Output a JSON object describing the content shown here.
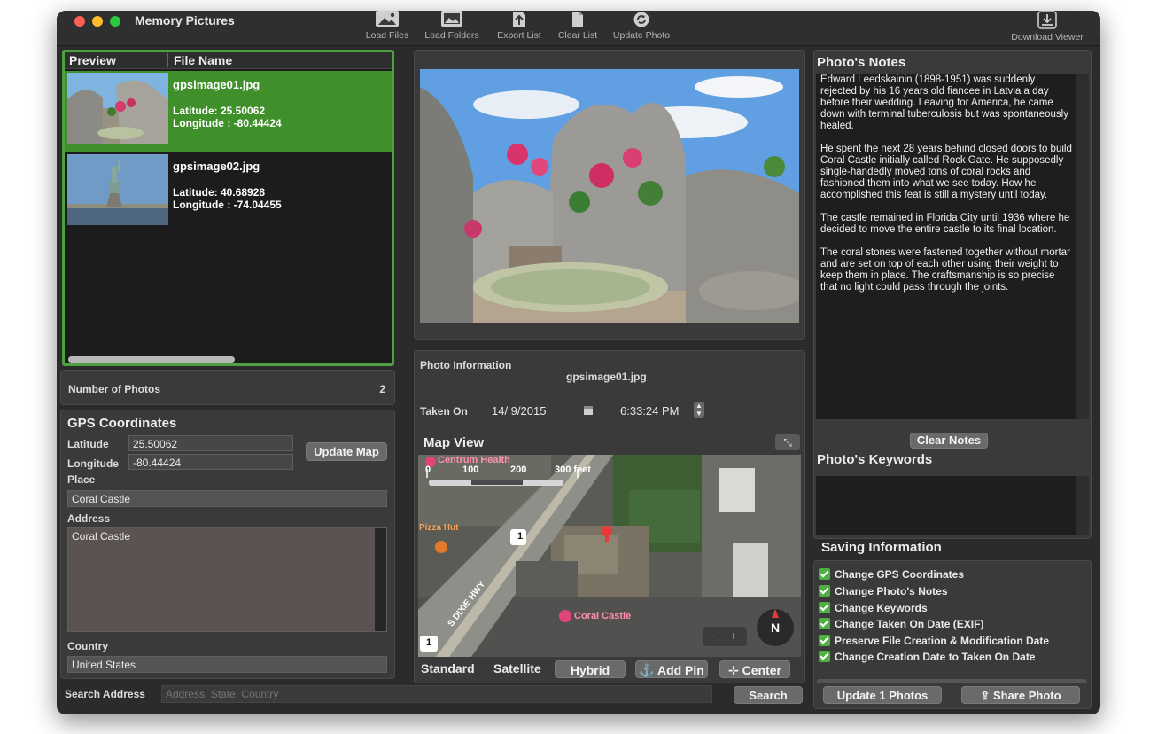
{
  "app": {
    "title": "Memory Pictures"
  },
  "toolbar": {
    "load_files": "Load Files",
    "load_folders": "Load Folders",
    "export_list": "Export List",
    "clear_list": "Clear List",
    "update_photo": "Update Photo",
    "download_viewer": "Download Viewer"
  },
  "list": {
    "col_preview": "Preview",
    "col_filename": "File Name",
    "items": [
      {
        "filename": "gpsimage01.jpg",
        "latitude": "Latitude: 25.50062",
        "longitude": "Longitude : -80.44424",
        "selected": true
      },
      {
        "filename": "gpsimage02.jpg",
        "latitude": "Latitude: 40.68928",
        "longitude": "Longitude : -74.04455",
        "selected": false
      }
    ]
  },
  "count": {
    "label": "Number of Photos",
    "value": "2"
  },
  "gps": {
    "title": "GPS Coordinates",
    "latitude_label": "Latitude",
    "latitude_value": "25.50062",
    "longitude_label": "Longitude",
    "longitude_value": "-80.44424",
    "update_map": "Update Map",
    "place_label": "Place",
    "place_value": "Coral Castle",
    "address_label": "Address",
    "address_value": "Coral Castle",
    "country_label": "Country",
    "country_value": "United States"
  },
  "search": {
    "label": "Search Address",
    "placeholder": "Address, State, Country",
    "button": "Search"
  },
  "photo_info": {
    "title": "Photo Information",
    "filename": "gpsimage01.jpg",
    "taken_on_label": "Taken On",
    "date": "14/ 9/2015",
    "time": "6:33:24 PM"
  },
  "map": {
    "title": "Map View",
    "poi_health": "Centrum Health",
    "poi_pizza": "Pizza Hut",
    "poi_castle": "Coral Castle",
    "road_dixie": "S DIXIE HWY",
    "scale_0": "0",
    "scale_100": "100",
    "scale_200": "200",
    "scale_300": "300 feet",
    "route_1": "1",
    "compass": "N",
    "zoom_out": "−",
    "zoom_in": "+",
    "tab_standard": "Standard",
    "tab_satellite": "Satellite",
    "tab_hybrid": "Hybrid",
    "add_pin": "Add Pin",
    "center": "Center"
  },
  "notes": {
    "title": "Photo's Notes",
    "paragraphs": [
      "Edward Leedskainin (1898-1951) was suddenly rejected by his 16 years old fiancee in Latvia a day before their wedding. Leaving for America, he came down with terminal tuberculosis but was spontaneously healed.",
      "He spent the next 28 years behind closed doors to build Coral Castle initially called Rock Gate. He supposedly single-handedly moved tons of coral rocks and fashioned them into what we see today. How he accomplished this feat is still a mystery until today.",
      "The castle remained in Florida City until 1936 where he decided to move the entire castle to its final location.",
      "The coral stones were fastened together without mortar and are set on top of each other using their weight to keep them in place. The craftsmanship is so precise that no light could pass through the joints."
    ],
    "clear_notes": "Clear Notes"
  },
  "keywords": {
    "title": "Photo's Keywords"
  },
  "saving": {
    "title": "Saving Information",
    "options": [
      "Change GPS Coordinates",
      "Change Photo's Notes",
      "Change Keywords",
      "Change Taken On Date (EXIF)",
      "Preserve File Creation & Modification Date",
      "Change Creation Date to Taken On Date"
    ],
    "update_button": "Update 1 Photos",
    "share_button": "Share Photo"
  },
  "colors": {
    "selection": "#3f8f2a",
    "accent_green": "#4fa043",
    "background": "#2b2b2b"
  }
}
